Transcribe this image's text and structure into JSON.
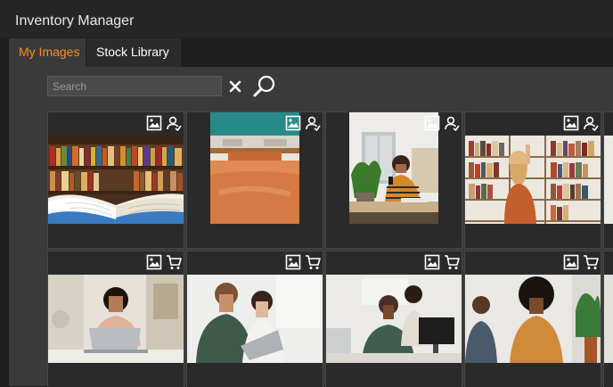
{
  "window": {
    "title": "Inventory Manager"
  },
  "tabs": [
    {
      "label": "My Images",
      "active": true
    },
    {
      "label": "Stock Library",
      "active": false
    }
  ],
  "search": {
    "placeholder": "Search",
    "value": ""
  },
  "colors": {
    "accent": "#ff8c1a",
    "panel": "#3a3a3a",
    "card": "#2a2a2a",
    "background": "#1f1f1f"
  },
  "cards": [
    {
      "row": 1,
      "image": "open-book-on-library-desk",
      "icons": [
        "image-icon",
        "user-icon"
      ]
    },
    {
      "row": 1,
      "image": "wooden-classroom-desk",
      "icons": [
        "image-icon",
        "user-icon"
      ]
    },
    {
      "row": 1,
      "image": "woman-with-phone-at-desk",
      "icons": [
        "image-icon",
        "user-icon"
      ]
    },
    {
      "row": 1,
      "image": "woman-browsing-bookshelf",
      "icons": [
        "image-icon",
        "user-icon"
      ]
    },
    {
      "row": 2,
      "image": "woman-using-laptop",
      "icons": [
        "image-icon",
        "cart-icon"
      ]
    },
    {
      "row": 2,
      "image": "colleagues-with-laptop",
      "icons": [
        "image-icon",
        "cart-icon"
      ]
    },
    {
      "row": 2,
      "image": "team-at-office-computer",
      "icons": [
        "image-icon",
        "cart-icon"
      ]
    },
    {
      "row": 2,
      "image": "women-meeting-in-office",
      "icons": [
        "image-icon",
        "cart-icon"
      ]
    }
  ]
}
